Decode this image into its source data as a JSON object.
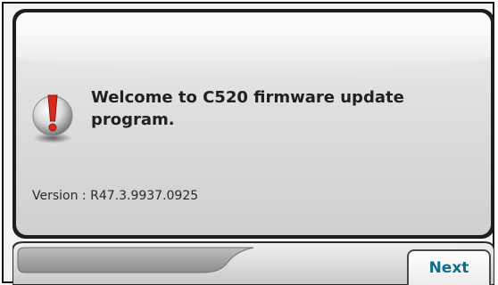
{
  "dialog": {
    "icon": "exclamation-icon",
    "message": "Welcome to C520 firmware update program.",
    "version": "Version : R47.3.9937.0925"
  },
  "footer": {
    "next_label": "Next"
  },
  "colors": {
    "next_text": "#0f6f88",
    "icon_red": "#d52a1e",
    "dialog_bg": "#dcdcdc",
    "frame_dark": "#1e1e1e"
  }
}
